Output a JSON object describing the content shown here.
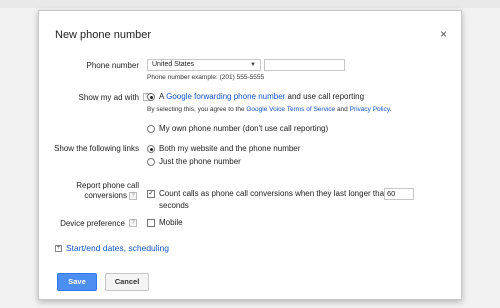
{
  "dialog": {
    "title": "New phone number",
    "close_label": "×"
  },
  "phone": {
    "label": "Phone number",
    "country_selected": "United States",
    "example": "Phone number example: (201) 555-5555"
  },
  "show_ad": {
    "label": "Show my ad with",
    "option1_prefix": "A ",
    "option1_link": "Google forwarding phone number",
    "option1_suffix": " and use call reporting",
    "terms_prefix": "By selecting this, you agree to the ",
    "terms_link": "Google Voice Terms of Service",
    "terms_and": " and ",
    "privacy_link": "Privacy Policy",
    "terms_end": ".",
    "option2": "My own phone number (don't use call reporting)"
  },
  "links": {
    "label": "Show the following links",
    "option1": "Both my website and the phone number",
    "option2": "Just the phone number"
  },
  "conversions": {
    "label_line1": "Report phone call",
    "label_line2": "conversions",
    "checkbox_text": "Count calls as phone call conversions when they last longer than",
    "value": "60",
    "unit": "seconds"
  },
  "device": {
    "label": "Device preference",
    "checkbox_text": "Mobile"
  },
  "schedule": {
    "expand_symbol": "+",
    "link": "Start/end dates, scheduling"
  },
  "buttons": {
    "save": "Save",
    "cancel": "Cancel"
  },
  "help_symbol": "?"
}
